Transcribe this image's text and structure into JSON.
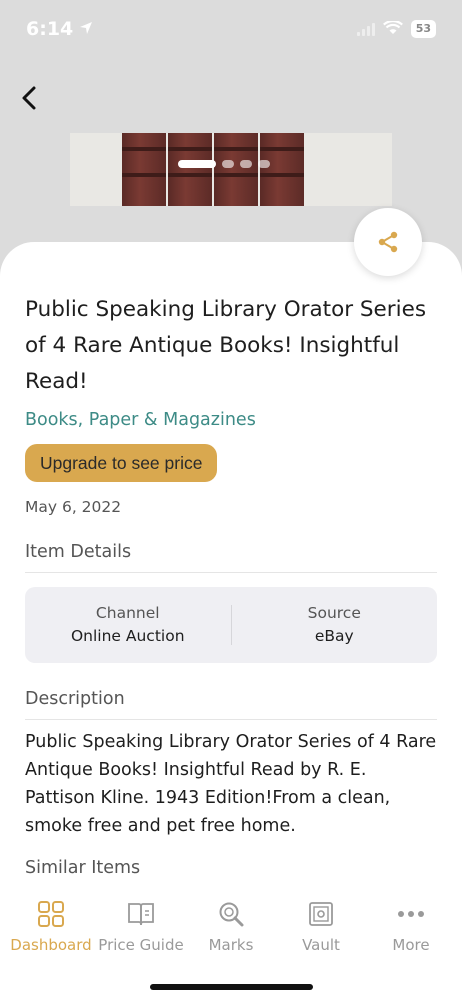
{
  "status_bar": {
    "time": "6:14",
    "battery": "53"
  },
  "hero": {
    "pages": 4,
    "active_page": 1
  },
  "item": {
    "title": "Public Speaking Library Orator Series of 4 Rare Antique Books! Insightful Read!",
    "category": "Books, Paper & Magazines",
    "upgrade_label": "Upgrade to see price",
    "date": "May 6, 2022"
  },
  "details": {
    "section_title": "Item Details",
    "channel_label": "Channel",
    "channel_value": "Online Auction",
    "source_label": "Source",
    "source_value": "eBay"
  },
  "description": {
    "section_title": "Description",
    "text": "Public Speaking Library Orator Series of 4 Rare Antique Books! Insightful Read by R. E. Pattison Kline. 1943 Edition!From a clean, smoke free and pet free home."
  },
  "similar": {
    "section_title": "Similar Items"
  },
  "tabs": [
    {
      "label": "Dashboard",
      "icon": "grid-icon",
      "active": true
    },
    {
      "label": "Price Guide",
      "icon": "book-icon",
      "active": false
    },
    {
      "label": "Marks",
      "icon": "magnifier-icon",
      "active": false
    },
    {
      "label": "Vault",
      "icon": "vault-icon",
      "active": false
    },
    {
      "label": "More",
      "icon": "dots-icon",
      "active": false
    }
  ],
  "colors": {
    "accent": "#d9a84f",
    "category": "#3d8b86"
  }
}
